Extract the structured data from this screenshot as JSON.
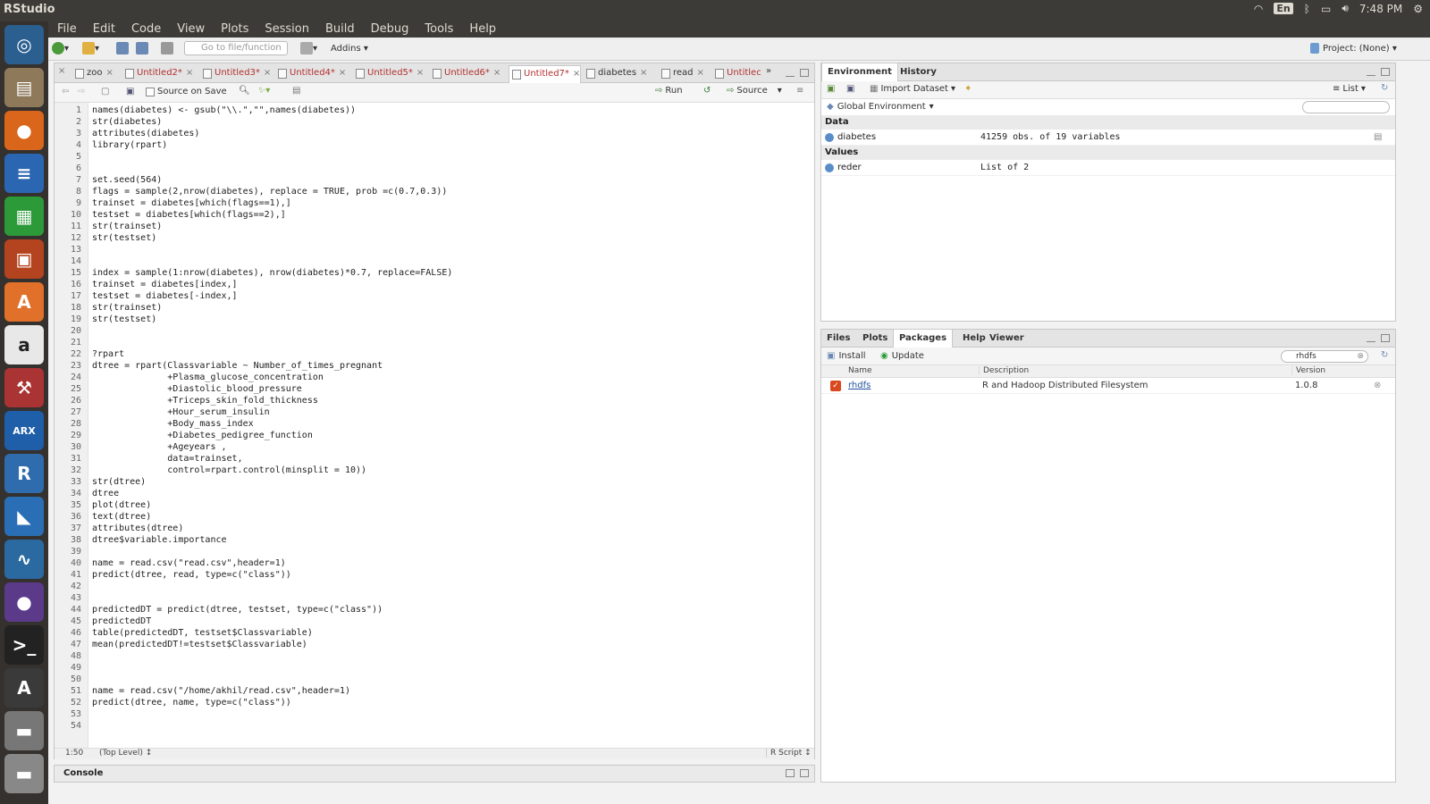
{
  "os": {
    "app_title": "RStudio",
    "lang": "En",
    "time": "7:48 PM"
  },
  "menubar": [
    "File",
    "Edit",
    "Code",
    "View",
    "Plots",
    "Session",
    "Build",
    "Debug",
    "Tools",
    "Help"
  ],
  "toolbar": {
    "goto_placeholder": "Go to file/function",
    "addins": "Addins",
    "project": "Project: (None)"
  },
  "editor": {
    "tabs": [
      {
        "label": "zoo",
        "modified": false,
        "active": false
      },
      {
        "label": "Untitled2*",
        "modified": true,
        "active": false
      },
      {
        "label": "Untitled3*",
        "modified": true,
        "active": false
      },
      {
        "label": "Untitled4*",
        "modified": true,
        "active": false
      },
      {
        "label": "Untitled5*",
        "modified": true,
        "active": false
      },
      {
        "label": "Untitled6*",
        "modified": true,
        "active": false
      },
      {
        "label": "Untitled7*",
        "modified": true,
        "active": true
      },
      {
        "label": "diabetes",
        "modified": false,
        "active": false
      },
      {
        "label": "read",
        "modified": false,
        "active": false
      },
      {
        "label": "Untitlec",
        "modified": true,
        "active": false
      }
    ],
    "source_on_save": "Source on Save",
    "run": "Run",
    "source": "Source",
    "lines": [
      "names(diabetes) <- gsub(\"\\\\.\",\"\",names(diabetes))",
      "str(diabetes)",
      "attributes(diabetes)",
      "library(rpart)",
      "",
      "",
      "set.seed(564)",
      "flags = sample(2,nrow(diabetes), replace = TRUE, prob =c(0.7,0.3))",
      "trainset = diabetes[which(flags==1),]",
      "testset = diabetes[which(flags==2),]",
      "str(trainset)",
      "str(testset)",
      "",
      "",
      "index = sample(1:nrow(diabetes), nrow(diabetes)*0.7, replace=FALSE)",
      "trainset = diabetes[index,]",
      "testset = diabetes[-index,]",
      "str(trainset)",
      "str(testset)",
      "",
      "",
      "?rpart",
      "dtree = rpart(Classvariable ~ Number_of_times_pregnant",
      "              +Plasma_glucose_concentration",
      "              +Diastolic_blood_pressure",
      "              +Triceps_skin_fold_thickness",
      "              +Hour_serum_insulin",
      "              +Body_mass_index",
      "              +Diabetes_pedigree_function",
      "              +Ageyears ,",
      "              data=trainset,",
      "              control=rpart.control(minsplit = 10))",
      "str(dtree)",
      "dtree",
      "plot(dtree)",
      "text(dtree)",
      "attributes(dtree)",
      "dtree$variable.importance",
      "",
      "name = read.csv(\"read.csv\",header=1)",
      "predict(dtree, read, type=c(\"class\"))",
      "",
      "",
      "predictedDT = predict(dtree, testset, type=c(\"class\"))",
      "predictedDT",
      "table(predictedDT, testset$Classvariable)",
      "mean(predictedDT!=testset$Classvariable)",
      "",
      "",
      "",
      "name = read.csv(\"/home/akhil/read.csv\",header=1)",
      "predict(dtree, name, type=c(\"class\"))",
      "",
      ""
    ],
    "status_pos": "1:50",
    "status_scope": "(Top Level)",
    "status_type": "R Script"
  },
  "console": {
    "title": "Console"
  },
  "environment": {
    "tabs": [
      "Environment",
      "History"
    ],
    "import_dataset": "Import Dataset",
    "list_label": "List",
    "global_env": "Global Environment",
    "data_header": "Data",
    "values_header": "Values",
    "data_rows": [
      {
        "name": "diabetes",
        "value": "41259 obs. of 19 variables"
      }
    ],
    "value_rows": [
      {
        "name": "reder",
        "value": "List of 2"
      }
    ]
  },
  "files": {
    "tabs": [
      "Files",
      "Plots",
      "Packages",
      "Help",
      "Viewer"
    ],
    "install": "Install",
    "update": "Update",
    "search_value": "rhdfs",
    "columns": [
      "Name",
      "Description",
      "Version"
    ],
    "packages": [
      {
        "name": "rhdfs",
        "description": "R and Hadoop Distributed Filesystem",
        "version": "1.0.8"
      }
    ]
  }
}
